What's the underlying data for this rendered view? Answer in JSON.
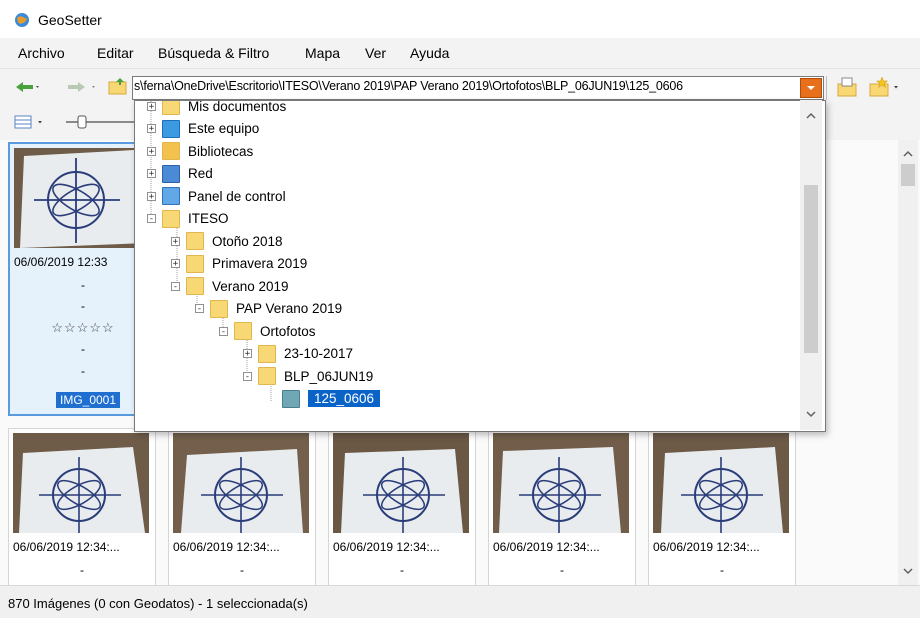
{
  "window": {
    "title": "GeoSetter"
  },
  "menu": [
    "Archivo",
    "Editar",
    "Búsqueda & Filtro",
    "Mapa",
    "Ver",
    "Ayuda"
  ],
  "address": {
    "path": "s\\ferna\\OneDrive\\Escritorio\\ITESO\\Verano 2019\\PAP Verano 2019\\Ortofotos\\BLP_06JUN19\\125_0606"
  },
  "tree": [
    {
      "label": "Mis documentos",
      "indent": 0,
      "expander": "+",
      "icon": "documents-folder-icon"
    },
    {
      "label": "Este equipo",
      "indent": 0,
      "expander": "+",
      "icon": "computer-icon"
    },
    {
      "label": "Bibliotecas",
      "indent": 0,
      "expander": "+",
      "icon": "libraries-icon"
    },
    {
      "label": "Red",
      "indent": 0,
      "expander": "+",
      "icon": "network-icon"
    },
    {
      "label": "Panel de control",
      "indent": 0,
      "expander": "+",
      "icon": "control-panel-icon"
    },
    {
      "label": "ITESO",
      "indent": 0,
      "expander": "−",
      "icon": "folder-icon"
    },
    {
      "label": "Otoño 2018",
      "indent": 1,
      "expander": "+",
      "icon": "folder-icon"
    },
    {
      "label": "Primavera 2019",
      "indent": 1,
      "expander": "+",
      "icon": "folder-icon"
    },
    {
      "label": "Verano 2019",
      "indent": 1,
      "expander": "−",
      "icon": "folder-icon"
    },
    {
      "label": "PAP Verano 2019",
      "indent": 2,
      "expander": "−",
      "icon": "folder-icon"
    },
    {
      "label": "Ortofotos",
      "indent": 3,
      "expander": "−",
      "icon": "folder-icon"
    },
    {
      "label": "23-10-2017",
      "indent": 4,
      "expander": "+",
      "icon": "folder-icon"
    },
    {
      "label": "BLP_06JUN19",
      "indent": 4,
      "expander": "−",
      "icon": "folder-icon"
    },
    {
      "label": "125_0606",
      "indent": 5,
      "expander": "",
      "icon": "folder-icon",
      "selected": true
    }
  ],
  "selected_thumb": {
    "date": "06/06/2019 12:33",
    "dash": "-",
    "stars": "☆☆☆☆☆",
    "filename": "IMG_0001"
  },
  "thumbs": [
    {
      "date": "06/06/2019 12:34:...",
      "dash": "-"
    },
    {
      "date": "06/06/2019 12:34:...",
      "dash": "-"
    },
    {
      "date": "06/06/2019 12:34:...",
      "dash": "-"
    },
    {
      "date": "06/06/2019 12:34:...",
      "dash": "-"
    },
    {
      "date": "06/06/2019 12:34:...",
      "dash": "-"
    }
  ],
  "status": {
    "text": "870 Imágenes (0 con Geodatos) - 1 seleccionada(s)"
  },
  "colors": {
    "accent": "#0078d7",
    "selection": "#0a64c8",
    "folder": "#f8d775",
    "address_drop": "#e8701c"
  }
}
